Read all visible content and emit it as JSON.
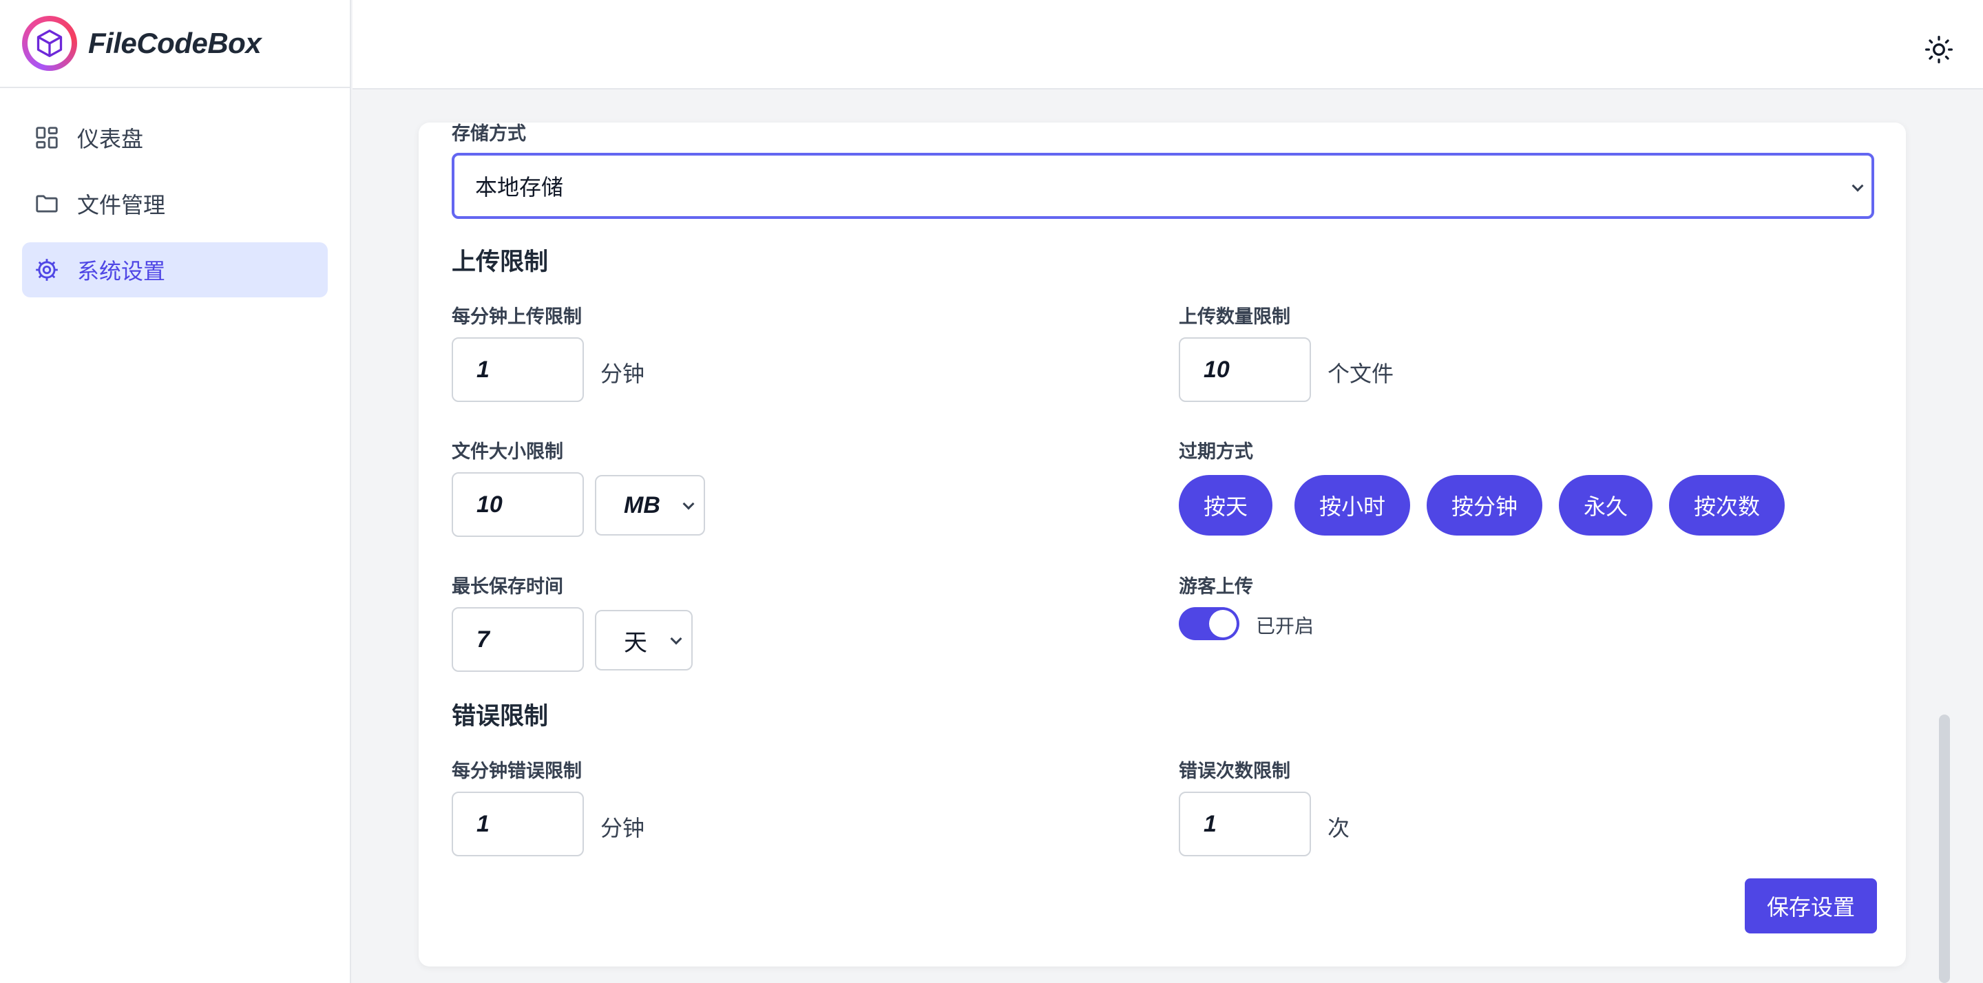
{
  "app": {
    "name": "FileCodeBox"
  },
  "sidebar": {
    "items": [
      {
        "label": "仪表盘",
        "icon": "dashboard-icon"
      },
      {
        "label": "文件管理",
        "icon": "folder-icon"
      },
      {
        "label": "系统设置",
        "icon": "gear-icon",
        "active": true
      }
    ]
  },
  "header": {
    "theme_icon": "sun-icon"
  },
  "settings": {
    "storage": {
      "label": "存储方式",
      "value": "本地存储"
    },
    "upload_section": "上传限制",
    "upload_per_minute": {
      "label": "每分钟上传限制",
      "value": "1",
      "unit": "分钟"
    },
    "upload_count": {
      "label": "上传数量限制",
      "value": "10",
      "unit": "个文件"
    },
    "file_size": {
      "label": "文件大小限制",
      "value": "10",
      "unit": "MB"
    },
    "expire": {
      "label": "过期方式",
      "options": [
        "按天",
        "按小时",
        "按分钟",
        "永久",
        "按次数"
      ]
    },
    "max_keep": {
      "label": "最长保存时间",
      "value": "7",
      "unit": "天"
    },
    "guest_upload": {
      "label": "游客上传",
      "status": "已开启",
      "enabled": true
    },
    "error_section": "错误限制",
    "error_per_minute": {
      "label": "每分钟错误限制",
      "value": "1",
      "unit": "分钟"
    },
    "error_count": {
      "label": "错误次数限制",
      "value": "1",
      "unit": "次"
    },
    "save_label": "保存设置"
  },
  "colors": {
    "accent": "#4f46e5",
    "accent_light": "#e0e7ff",
    "border": "#d1d5db"
  }
}
